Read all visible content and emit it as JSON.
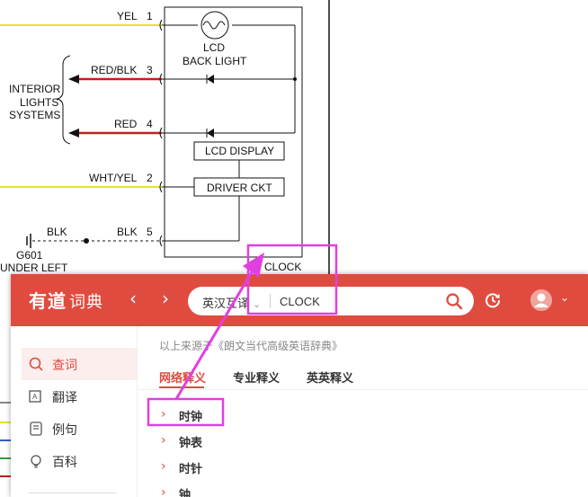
{
  "diagram": {
    "wires": [
      {
        "label": "YEL",
        "pin": "1"
      },
      {
        "label": "RED/BLK",
        "pin": "3"
      },
      {
        "label": "RED",
        "pin": "4"
      },
      {
        "label": "WHT/YEL",
        "pin": "2"
      },
      {
        "label": "BLK",
        "pin": "5"
      }
    ],
    "side_label": [
      "INTERIOR",
      "LIGHTS",
      "SYSTEMS"
    ],
    "components": {
      "bulb_label": [
        "LCD",
        "BACK LIGHT"
      ],
      "lcd_display": "LCD DISPLAY",
      "driver_ckt": "DRIVER CKT",
      "clock": "CLOCK"
    },
    "ground": {
      "wire_label": "BLK",
      "name": "G601",
      "location": "UNDER LEFT"
    }
  },
  "app": {
    "logo": "有道",
    "logo_sub": "词典",
    "nav_back": "‹",
    "nav_forward": "›",
    "search": {
      "language": "英汉互译",
      "query": "CLOCK"
    },
    "sidebar": {
      "items": [
        {
          "label": "查词",
          "icon": "search-word-icon",
          "active": true
        },
        {
          "label": "翻译",
          "icon": "translate-icon",
          "active": false
        },
        {
          "label": "例句",
          "icon": "example-sentence-icon",
          "active": false
        },
        {
          "label": "百科",
          "icon": "encyclopedia-icon",
          "active": false
        }
      ]
    },
    "source_text": "以上来源于《朗文当代高级英语辞典》",
    "tabs": [
      {
        "label": "网络释义",
        "active": true
      },
      {
        "label": "专业释义",
        "active": false
      },
      {
        "label": "英英释义",
        "active": false
      }
    ],
    "results": [
      "时钟",
      "钟表",
      "时针",
      "钟"
    ],
    "colors": {
      "brand": "#e04b3f",
      "highlight": "#e040e0"
    }
  }
}
